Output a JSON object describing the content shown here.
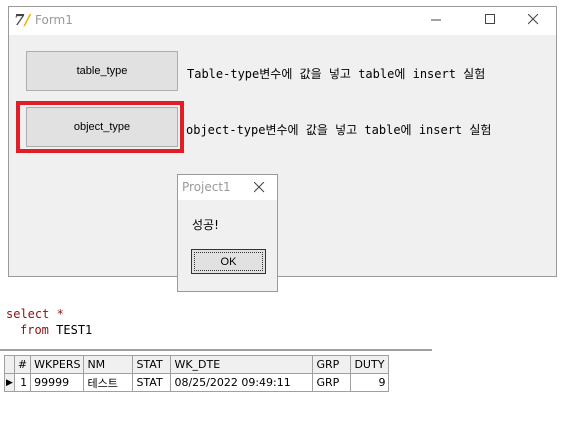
{
  "form1": {
    "title": "Form1",
    "minimize_icon": "minimize-icon",
    "maximize_icon": "maximize-icon",
    "close_icon": "close-icon",
    "table_type_button": "table_type",
    "table_type_desc": "Table-type변수에 값을 넣고 table에 insert 실험",
    "object_type_button": "object_type",
    "object_type_desc": "object-type변수에 값을 넣고 table에 insert 실험",
    "highlight_color": "#e01e25"
  },
  "dialog": {
    "title": "Project1",
    "message": "성공!",
    "ok_label": "OK"
  },
  "sql": {
    "line1_kw": "select",
    "line1_sym": "*",
    "line2_kw": "from",
    "line2_table": "TEST1"
  },
  "grid": {
    "columns": [
      "#",
      "WKPERS",
      "NM",
      "STAT",
      "WK_DTE",
      "GRP",
      "DUTY"
    ],
    "rows": [
      [
        "1",
        "99999",
        "테스트",
        "STAT",
        "08/25/2022 09:49:11",
        "GRP",
        "9"
      ]
    ]
  }
}
